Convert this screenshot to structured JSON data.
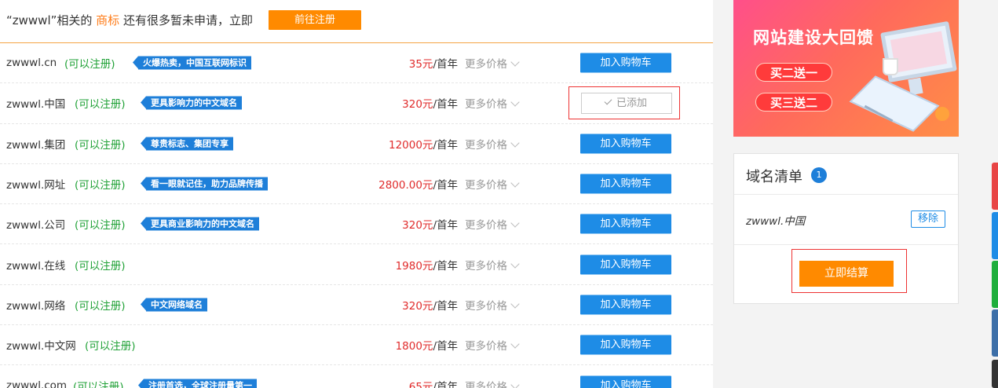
{
  "notice": {
    "text_before": "“zwwwl”相关的",
    "text_highlight": "商标",
    "text_after": "还有很多暂未申请，立即",
    "button_label": "前往注册"
  },
  "rows": [
    {
      "domain": "zwwwl.cn",
      "status": "(可以注册)",
      "badge": "火爆热卖，中国互联网标识",
      "price": "35元",
      "unit": "/首年",
      "more": "更多价格",
      "action": "加入购物车",
      "added": false
    },
    {
      "domain": "zwwwl.中国",
      "status": "(可以注册)",
      "badge": "更具影响力的中文域名",
      "price": "320元",
      "unit": "/首年",
      "more": "更多价格",
      "action": "已添加",
      "added": true
    },
    {
      "domain": "zwwwl.集团",
      "status": "(可以注册)",
      "badge": "尊贵标志、集团专享",
      "price": "12000元",
      "unit": "/首年",
      "more": "更多价格",
      "action": "加入购物车",
      "added": false
    },
    {
      "domain": "zwwwl.网址",
      "status": "(可以注册)",
      "badge": "看一眼就记住，助力品牌传播",
      "price": "2800.00元",
      "unit": "/首年",
      "more": "更多价格",
      "action": "加入购物车",
      "added": false
    },
    {
      "domain": "zwwwl.公司",
      "status": "(可以注册)",
      "badge": "更具商业影响力的中文域名",
      "price": "320元",
      "unit": "/首年",
      "more": "更多价格",
      "action": "加入购物车",
      "added": false
    },
    {
      "domain": "zwwwl.在线",
      "status": "(可以注册)",
      "badge": "",
      "price": "1980元",
      "unit": "/首年",
      "more": "更多价格",
      "action": "加入购物车",
      "added": false
    },
    {
      "domain": "zwwwl.网络",
      "status": "(可以注册)",
      "badge": "中文网络域名",
      "price": "320元",
      "unit": "/首年",
      "more": "更多价格",
      "action": "加入购物车",
      "added": false
    },
    {
      "domain": "zwwwl.中文网",
      "status": "(可以注册)",
      "badge": "",
      "price": "1800元",
      "unit": "/首年",
      "more": "更多价格",
      "action": "加入购物车",
      "added": false
    },
    {
      "domain": "zwwwl.com",
      "status": "(可以注册)",
      "badge": "注册首选，全球注册量第一",
      "price": "65元",
      "unit": "/首年",
      "more": "更多价格",
      "action": "加入购物车",
      "added": false
    }
  ],
  "banner": {
    "title": "网站建设大回馈",
    "tag1": "买二送一",
    "tag2": "买三送二"
  },
  "cart": {
    "title": "域名清单",
    "count": "1",
    "item": "zwwwl.中国",
    "remove_label": "移除",
    "checkout_label": "立即结算"
  },
  "side_tabs": [
    "#e84545",
    "#1e8ce6",
    "#1fae3c",
    "#3d6fa8",
    "#333333"
  ]
}
